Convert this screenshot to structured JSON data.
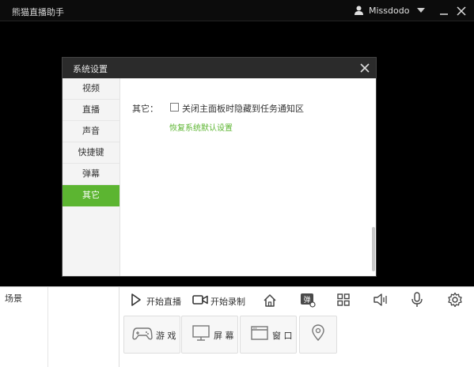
{
  "titlebar": {
    "app_title": "熊猫直播助手",
    "username": "Missdodo"
  },
  "dialog": {
    "title": "系统设置",
    "nav": [
      "视频",
      "直播",
      "声音",
      "快捷键",
      "弹幕",
      "其它"
    ],
    "active_nav": "其它",
    "content": {
      "section_label": "其它：",
      "checkbox_label": "关闭主面板时隐藏到任务通知区",
      "checkbox_checked": false,
      "restore_link": "恢复系统默认设置"
    }
  },
  "bottom": {
    "scene_label": "场景",
    "toolbar": {
      "start_live": "开始直播",
      "start_record": "开始录制"
    },
    "sources": [
      {
        "label": "游 戏",
        "icon": "gamepad-icon"
      },
      {
        "label": "屏 幕",
        "icon": "monitor-icon"
      },
      {
        "label": "窗 口",
        "icon": "window-icon"
      }
    ]
  },
  "colors": {
    "accent": "#5cb531",
    "titlebar": "#0c0c0c",
    "dialog_header": "#2b2b2b"
  }
}
